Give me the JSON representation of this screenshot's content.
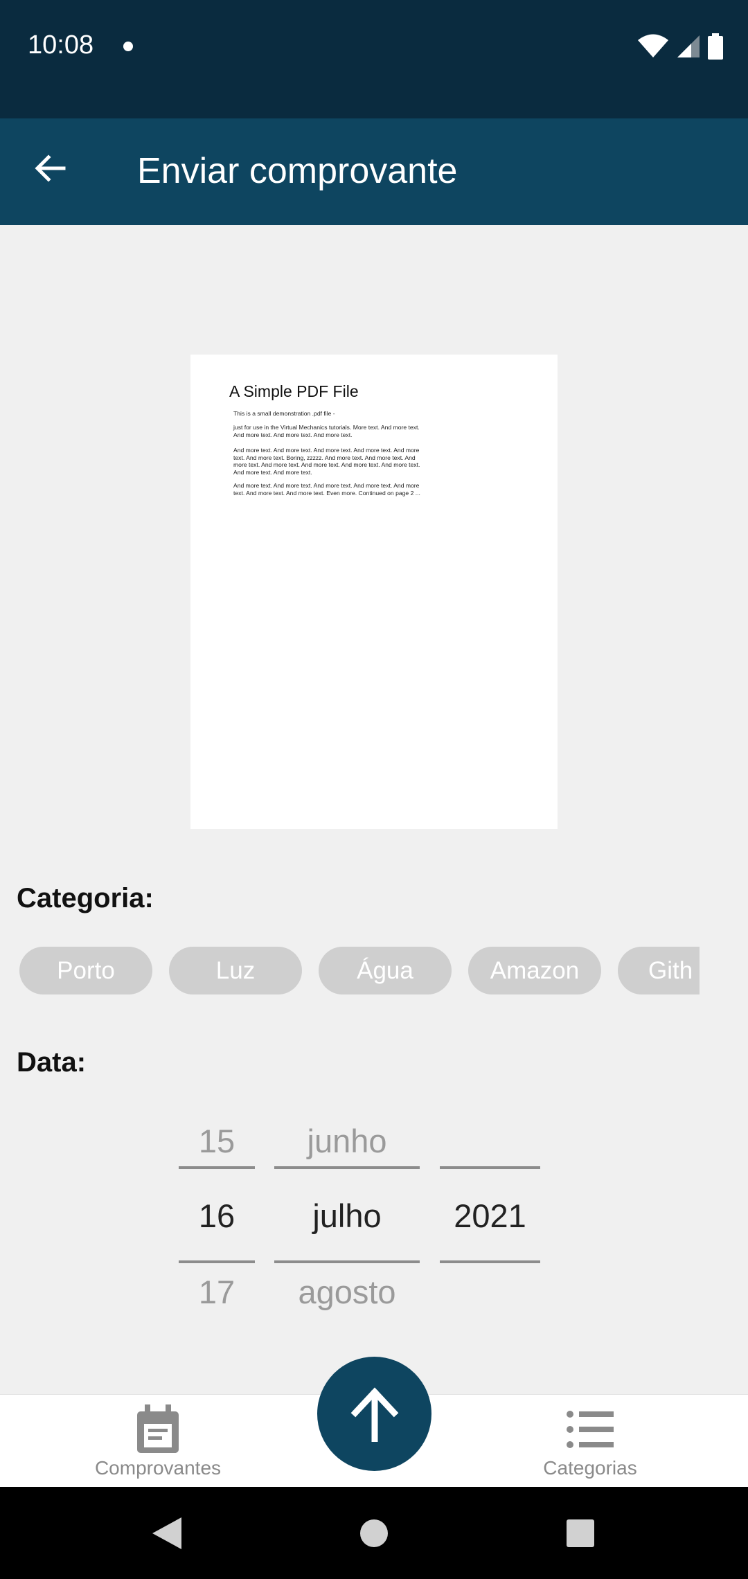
{
  "status_bar": {
    "time": "10:08",
    "icons": [
      "notification-dot-icon",
      "wifi-icon",
      "signal-icon",
      "battery-icon"
    ]
  },
  "app_bar": {
    "title": "Enviar comprovante",
    "back_icon": "arrow-back-icon"
  },
  "pdf_preview": {
    "title": "A Simple PDF File",
    "paragraphs": [
      "This is a small demonstration .pdf file -",
      "just for use in the Virtual Mechanics tutorials. More text. And more text. And more text. And more text. And more text.",
      "And more text. And more text. And more text. And more text. And more text. And more text. Boring, zzzzz. And more text. And more text. And more text. And more text. And more text. And more text. And more text. And more text. And more text.",
      "And more text. And more text. And more text. And more text. And more text. And more text. And more text. Even more. Continued on page 2 ..."
    ]
  },
  "category": {
    "label": "Categoria:",
    "chips": [
      "Porto",
      "Luz",
      "Água",
      "Amazon",
      "Gith"
    ]
  },
  "date": {
    "label": "Data:",
    "day": {
      "prev": "15",
      "current": "16",
      "next": "17"
    },
    "month": {
      "prev": "junho",
      "current": "julho",
      "next": "agosto"
    },
    "year": {
      "prev": "",
      "current": "2021",
      "next": ""
    }
  },
  "bottom_nav": {
    "left": {
      "label": "Comprovantes",
      "icon": "receipt-icon"
    },
    "fab": {
      "icon": "upload-arrow-icon"
    },
    "right": {
      "label": "Categorias",
      "icon": "list-icon"
    }
  },
  "system_nav": [
    "back-triangle-icon",
    "home-circle-icon",
    "recents-square-icon"
  ],
  "colors": {
    "status_bar": "#0a2b3f",
    "app_bar": "#0e4560",
    "chip_bg": "#cfcfcf",
    "background": "#f0f0f0"
  }
}
